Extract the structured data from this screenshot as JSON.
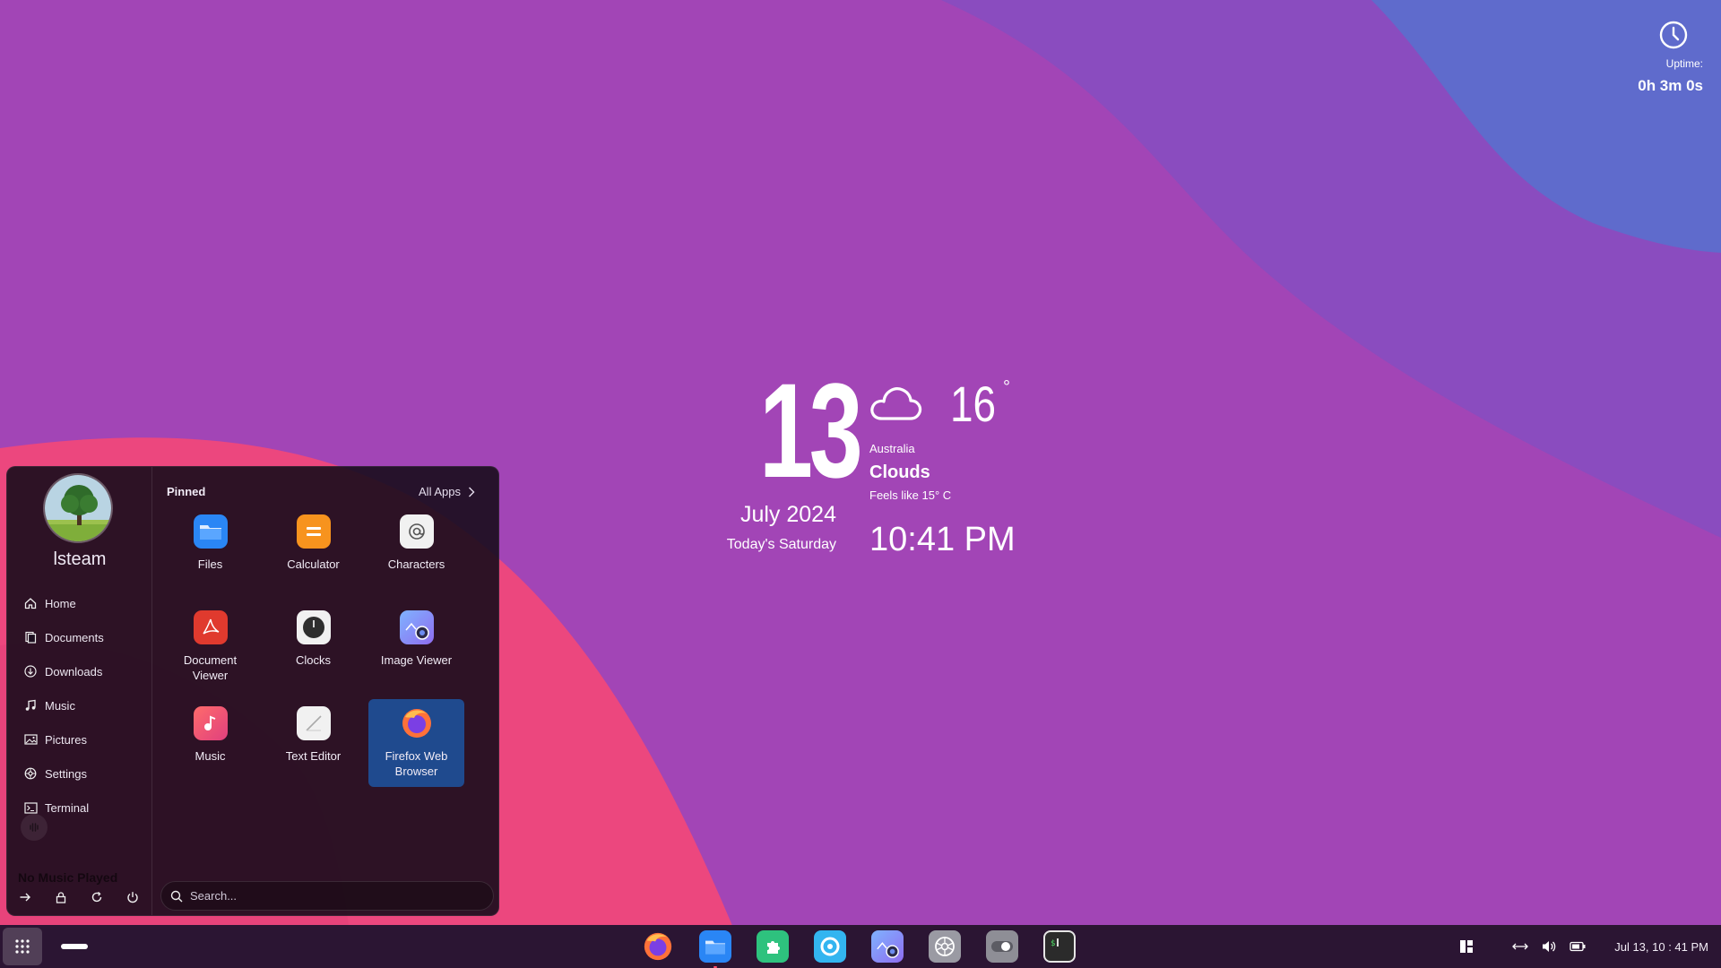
{
  "uptime": {
    "label": "Uptime:",
    "value": "0h 3m 0s"
  },
  "widget": {
    "day": "13",
    "month_year": "July 2024",
    "weekday": "Today's Saturday",
    "temperature": "16",
    "degree_symbol": "°",
    "country": "Australia",
    "condition": "Clouds",
    "feels_like": "Feels like 15° C",
    "time": "10:41 PM"
  },
  "menu": {
    "username": "lsteam",
    "sidebar": [
      {
        "label": "Home",
        "icon": "home-icon"
      },
      {
        "label": "Documents",
        "icon": "documents-icon"
      },
      {
        "label": "Downloads",
        "icon": "downloads-icon"
      },
      {
        "label": "Music",
        "icon": "music-note-icon"
      },
      {
        "label": "Pictures",
        "icon": "pictures-icon"
      },
      {
        "label": "Settings",
        "icon": "settings-icon"
      },
      {
        "label": "Terminal",
        "icon": "terminal-icon"
      }
    ],
    "no_music": "No Music Played",
    "pinned_label": "Pinned",
    "all_apps_label": "All Apps",
    "apps": [
      {
        "label": "Files",
        "icon": "files-icon",
        "color": "#2a86f5"
      },
      {
        "label": "Calculator",
        "icon": "calculator-icon",
        "color": "#f7931e"
      },
      {
        "label": "Characters",
        "icon": "characters-icon",
        "color": "#f1f1f1"
      },
      {
        "label": "Document Viewer",
        "icon": "document-viewer-icon",
        "color": "#e03a2e"
      },
      {
        "label": "Clocks",
        "icon": "clocks-icon",
        "color": "#f1f1f1"
      },
      {
        "label": "Image Viewer",
        "icon": "image-viewer-icon",
        "color": "#6c8cf0"
      },
      {
        "label": "Music",
        "icon": "music-app-icon",
        "color": "#f0506e"
      },
      {
        "label": "Text Editor",
        "icon": "text-editor-icon",
        "color": "#f1f1f1"
      },
      {
        "label": "Firefox Web Browser",
        "icon": "firefox-icon",
        "color": "#ff7139",
        "selected": true
      }
    ],
    "search_placeholder": "Search..."
  },
  "taskbar": {
    "dock": [
      {
        "name": "firefox-icon",
        "color": "#ff7139"
      },
      {
        "name": "files-icon",
        "color": "#2a86f5",
        "active": true
      },
      {
        "name": "extensions-icon",
        "color": "#2ec27e"
      },
      {
        "name": "browser-c-icon",
        "color": "#33b5f0"
      },
      {
        "name": "image-viewer-icon",
        "color": "#6c8cf0"
      },
      {
        "name": "settings-icon",
        "color": "#9a9aa3"
      },
      {
        "name": "toggle-icon",
        "color": "#8e8e96"
      },
      {
        "name": "terminal-icon",
        "color": "#2b2b2b"
      }
    ],
    "clock": "Jul 13, 10 : 41 PM"
  },
  "colors": {
    "wallpaper_base": "#a043b8",
    "wallpaper_blue": "#5e68c9",
    "wallpaper_pink": "#ee4a7f",
    "menu_selection": "#1f4a8e",
    "taskbar": "#2b1533"
  }
}
